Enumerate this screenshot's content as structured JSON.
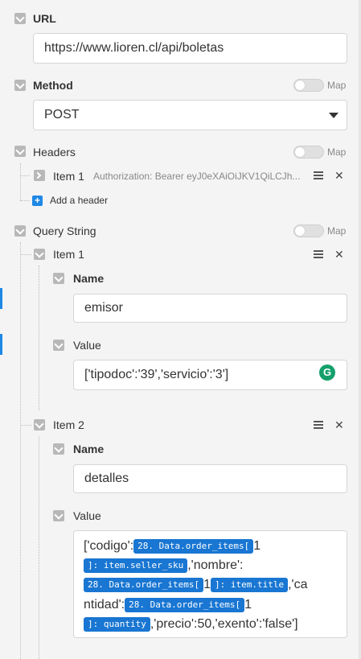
{
  "url": {
    "label": "URL",
    "value": "https://www.lioren.cl/api/boletas"
  },
  "method": {
    "label": "Method",
    "map_label": "Map",
    "value": "POST"
  },
  "headers": {
    "label": "Headers",
    "map_label": "Map",
    "item1_label": "Item 1",
    "item1_summary": "Authorization: Bearer eyJ0eXAiOiJKV1QiLCJh...",
    "add_label": "Add a header"
  },
  "query": {
    "label": "Query String",
    "map_label": "Map",
    "item1": {
      "label": "Item 1",
      "name_label": "Name",
      "name_value": "emisor",
      "value_label": "Value",
      "value_value": "['tipodoc':'39','servicio':'3']"
    },
    "item2": {
      "label": "Item 2",
      "name_label": "Name",
      "name_value": "detalles",
      "value_label": "Value",
      "value_parts": {
        "p1": "['codigo':",
        "pill1a": "28. Data.order_items[",
        "n1": "1",
        "pill1b": "]: item.seller_sku",
        "p2": ",'nombre':",
        "pill2a": "28. Data.order_items[",
        "n2": "1",
        "pill2b": "]: item.title",
        "p3": ",'ca",
        "p4": "ntidad':",
        "pill3a": "28. Data.order_items[",
        "n3": "1",
        "pill3b": "]: quantity",
        "p5": ",'precio':50,'exento':'false']"
      }
    }
  },
  "icons": {
    "grammarly": "G"
  }
}
